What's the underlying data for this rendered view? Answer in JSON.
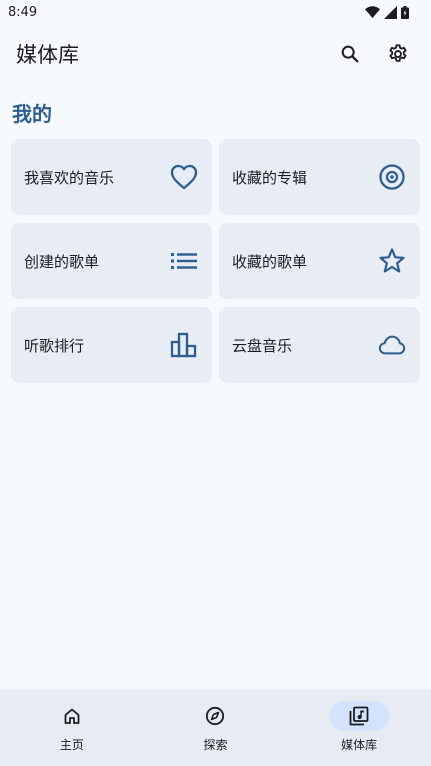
{
  "status_bar": {
    "time": "8:49",
    "icons": [
      "wifi-icon",
      "signal-icon",
      "battery-icon"
    ]
  },
  "app_bar": {
    "title": "媒体库",
    "actions": [
      "search-icon",
      "settings-icon"
    ]
  },
  "section": {
    "title": "我的"
  },
  "cards": [
    {
      "label": "我喜欢的音乐",
      "icon": "heart-icon"
    },
    {
      "label": "收藏的专辑",
      "icon": "album-icon"
    },
    {
      "label": "创建的歌单",
      "icon": "list-icon"
    },
    {
      "label": "收藏的歌单",
      "icon": "star-icon"
    },
    {
      "label": "听歌排行",
      "icon": "bar-chart-icon"
    },
    {
      "label": "云盘音乐",
      "icon": "cloud-icon"
    }
  ],
  "bottom_nav": {
    "items": [
      {
        "label": "主页",
        "icon": "home-icon",
        "active": false
      },
      {
        "label": "探索",
        "icon": "compass-icon",
        "active": false
      },
      {
        "label": "媒体库",
        "icon": "library-music-icon",
        "active": true
      }
    ]
  },
  "colors": {
    "accent": "#2e5e8f",
    "card_bg": "#e8ecf5",
    "page_bg": "#f6f9fe",
    "nav_bg": "#e7ebf3",
    "nav_active": "#d3e3fb"
  }
}
